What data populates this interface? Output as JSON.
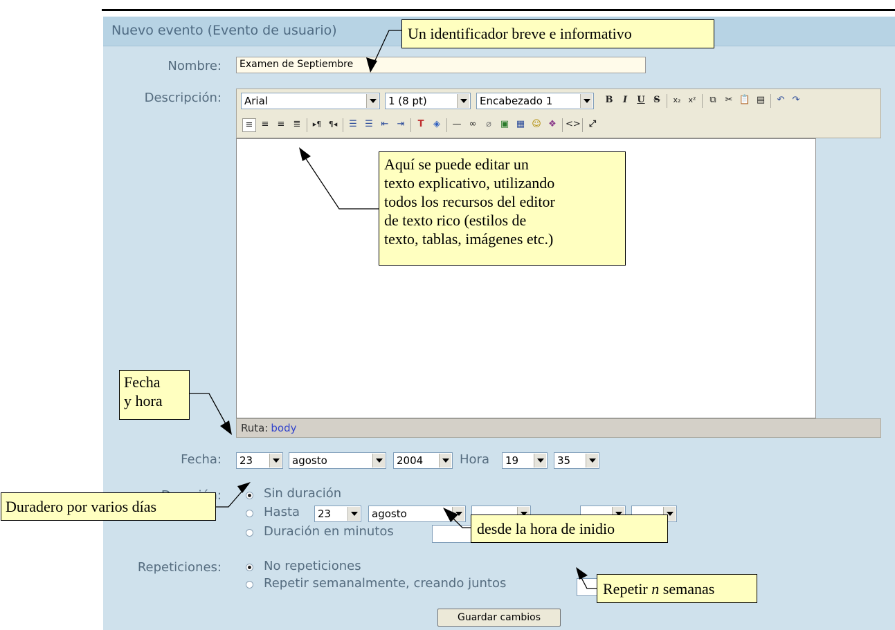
{
  "form": {
    "title": "Nuevo evento (Evento de usuario)",
    "name_label": "Nombre:",
    "name_value": "Examen de Septiembre",
    "desc_label": "Descripción:",
    "toolbar": {
      "font": "Arial",
      "size": "1 (8 pt)",
      "heading": "Encabezado 1",
      "bold": "B",
      "italic": "I",
      "underline": "U",
      "strike": "S"
    },
    "status_label": "Ruta:",
    "status_path": "body",
    "date_label": "Fecha:",
    "date": {
      "day": "23",
      "month": "agosto",
      "year": "2004",
      "hour_label": "Hora",
      "hour": "19",
      "minute": "35"
    },
    "duration_label": "Duración:",
    "duration_options": [
      "Sin duración",
      "Hasta",
      "Duración en minutos"
    ],
    "until": {
      "day": "23",
      "month": "agosto"
    },
    "repeat_label": "Repeticiones:",
    "repeat_options": [
      "No repeticiones",
      "Repetir semanalmente, creando juntos"
    ],
    "save_button": "Guardar cambios"
  },
  "callouts": {
    "identifier": "Un identificador breve e informativo",
    "editor": [
      "Aquí se puede editar un",
      "texto explicativo, utilizando",
      "todos los recursos del editor",
      "de texto rico (estilos de",
      "texto, tablas, imágenes etc.)"
    ],
    "date": [
      "Fecha",
      "y hora"
    ],
    "multiday": "Duradero por varios días",
    "from_start": "desde la hora de inidio",
    "repeat": {
      "prefix": "Repetir ",
      "n": "n",
      "suffix": " semanas"
    }
  },
  "colors": {
    "panel": "#cfe1ec",
    "header": "#b7d3e4",
    "label_text": "#556c7f",
    "callout_bg": "#ffffc0",
    "toolbar_bg": "#ece9d8"
  }
}
